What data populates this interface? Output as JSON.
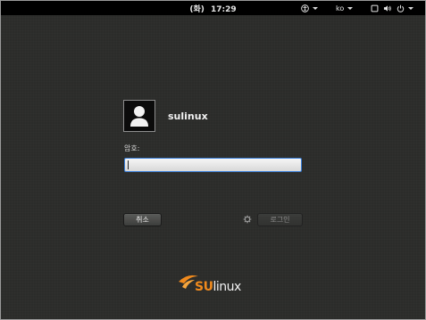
{
  "topbar": {
    "day": "(화)",
    "time": "17:29",
    "language": "ko",
    "icons": [
      "accessibility-icon",
      "screen-icon",
      "volume-icon",
      "power-icon"
    ]
  },
  "login": {
    "username": "sulinux",
    "password_label": "암호:",
    "password_value": "",
    "cancel_label": "취소",
    "login_label": "로그인"
  },
  "brand": {
    "logo_su": "SU",
    "logo_linux": "linux",
    "accent_color": "#f08a1d"
  }
}
